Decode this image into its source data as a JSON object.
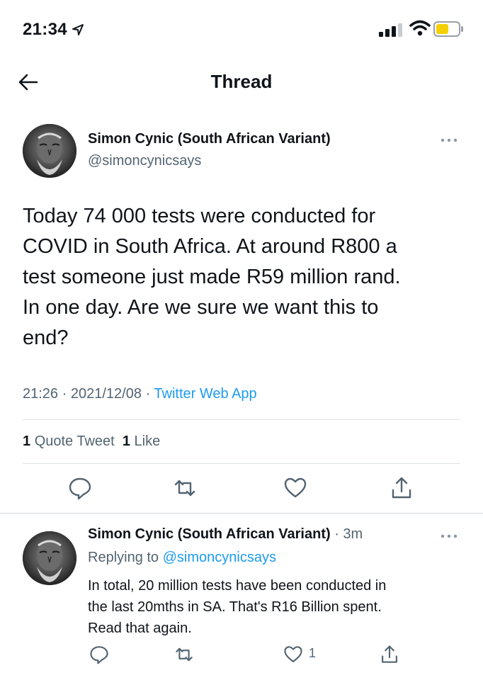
{
  "status_bar": {
    "time": "21:34",
    "icons": [
      "location-arrow-icon",
      "cellular-signal-icon",
      "wifi-icon",
      "battery-low-icon"
    ],
    "battery_color": "#f5d000"
  },
  "header": {
    "title": "Thread",
    "back_icon": "arrow-left-icon"
  },
  "main_tweet": {
    "author_name": "Simon Cynic (South African Variant)",
    "author_handle": "@simoncynicsays",
    "text_lines": [
      "Today 74 000 tests were conducted for",
      "COVID in South Africa. At around R800 a",
      "test someone just made R59 million rand.",
      "In one day. Are we sure we want this to",
      "end?"
    ],
    "time": "21:26",
    "date": "2021/12/08",
    "sep": "·",
    "source_app": "Twitter Web App",
    "quote_count": "1",
    "quote_label": "Quote Tweet",
    "like_count": "1",
    "like_label": "Like",
    "actions": [
      "reply-icon",
      "retweet-icon",
      "like-icon",
      "share-icon"
    ]
  },
  "reply_tweet": {
    "author_name": "Simon Cynic (South African Variant)",
    "time_ago": "· 3m",
    "replying_prefix": "Replying to",
    "replying_to": "@simoncynicsays",
    "text_lines": [
      "In total, 20 million tests have been conducted in",
      "the last 20mths in SA. That's R16 Billion spent.",
      "Read that again."
    ],
    "like_count": "1",
    "actions": [
      "reply-icon",
      "retweet-icon",
      "like-icon",
      "share-icon"
    ]
  },
  "colors": {
    "text": "#0f1419",
    "secondary": "#536471",
    "link": "#1d9bf0",
    "divider": "#dfe3e6"
  }
}
